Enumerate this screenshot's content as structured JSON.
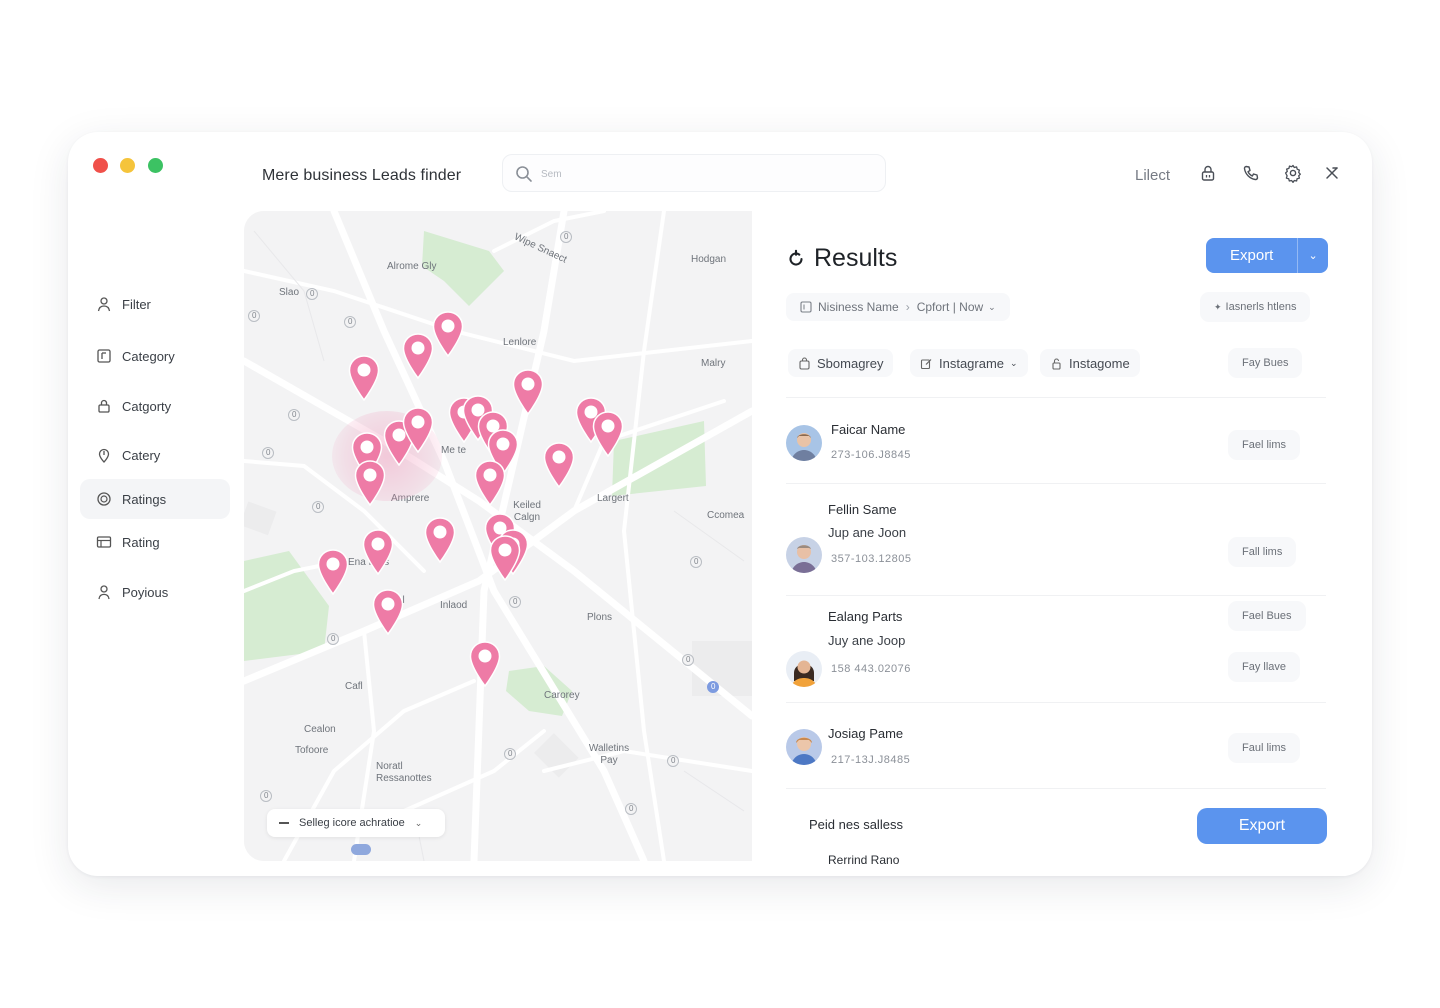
{
  "window": {
    "app_title": "Mere business Leads finder",
    "search": {
      "placeholder": "Sem"
    },
    "top_link": "Lilect",
    "top_icons": [
      "lock-icon",
      "phone-icon",
      "gear-icon",
      "close-icon"
    ]
  },
  "sidebar": {
    "items": [
      {
        "label": "Filter",
        "icon": "person-icon"
      },
      {
        "label": "Category",
        "icon": "tag-icon"
      },
      {
        "label": "Catgorty",
        "icon": "lock-icon"
      },
      {
        "label": "Catery",
        "icon": "location-icon"
      },
      {
        "label": "Ratings",
        "icon": "target-icon",
        "active": true
      },
      {
        "label": "Rating",
        "icon": "table-icon"
      },
      {
        "label": "Poyious",
        "icon": "person-icon"
      }
    ]
  },
  "map": {
    "labels": [
      "Alrome Gly",
      "Wipe Snaect",
      "Hodgan",
      "Slao",
      "Lenlore",
      "Malry",
      "Me te",
      "Amprere",
      "Keiled Calgn",
      "Largert",
      "Ccomea",
      "Ena Pars",
      "Iwel",
      "Inlaod",
      "Plons",
      "Carorey",
      "Cafl",
      "Cealon",
      "Tofoore",
      "Noratl Ressanottes",
      "Walletins Pay"
    ],
    "pin_color": "#ee7ba6",
    "select_label": "Selleg icore achratioe",
    "select_icon": "chevron-down-icon"
  },
  "results": {
    "title": "Results",
    "title_icon": "refresh-icon",
    "export_label": "Export",
    "breadcrumb": [
      "Nisiness Name",
      "Cpfort | Now"
    ],
    "breadcrumb_right": "Iasnerls htlens",
    "chips": [
      "Sbomagrey",
      "Instagrame",
      "Instagome"
    ],
    "chip_right": "Fay Bues",
    "rows": [
      {
        "name": "Faicar Name",
        "sub": "",
        "phone": "273-106.J8845",
        "actions": [
          "Fael lims"
        ]
      },
      {
        "name": "Fellin Same",
        "sub": "Jup ane Joon",
        "phone": "357-103.12805",
        "actions": [
          "Fall lims"
        ]
      },
      {
        "name": "Ealang Parts",
        "sub": "Juy ane Joop",
        "phone": "158 443.02076",
        "actions": [
          "Fael Bues",
          "Fay llave"
        ]
      },
      {
        "name": "Josiag Pame",
        "sub": "",
        "phone": "217-13J.J8485",
        "actions": [
          "Faul lims"
        ]
      }
    ],
    "footer_text": "Peid nes salless",
    "footer_export": "Export",
    "cut_row_name": "Rerrind Rano"
  }
}
